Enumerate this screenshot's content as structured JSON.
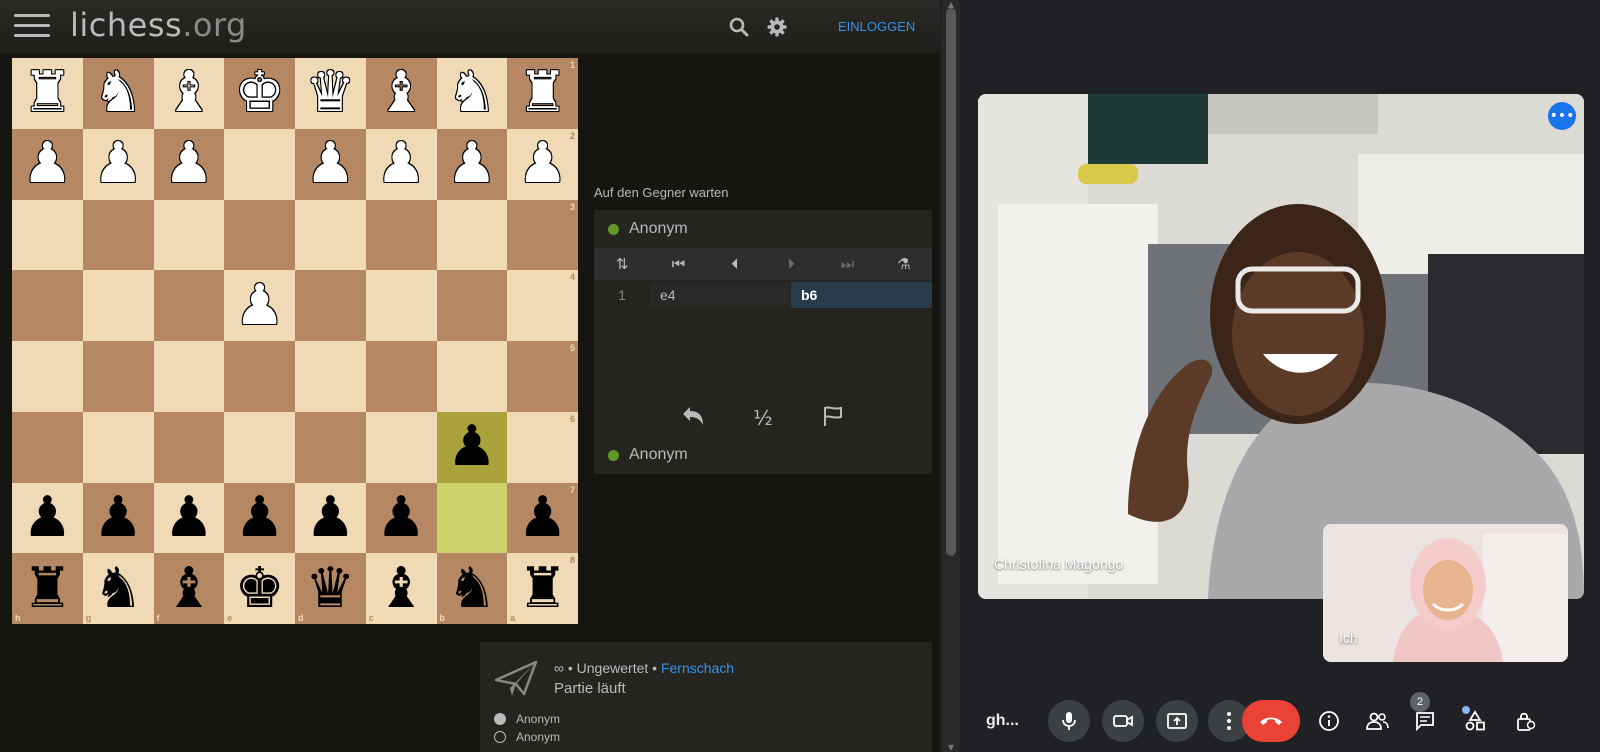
{
  "lichess": {
    "logo_main": "lichess",
    "logo_tld": ".org",
    "login_label": "EINLOGGEN",
    "waiting_text": "Auf den Gegner warten",
    "top_player": "Anonym",
    "bottom_player": "Anonym",
    "move_number": "1",
    "move_white": "e4",
    "move_black": "b6",
    "draw_label": "½",
    "game_meta_prefix": "∞ • Ungewertet • ",
    "game_meta_link": "Fernschach",
    "game_status": "Partie läuft",
    "white_player": "Anonym",
    "black_player": "Anonym",
    "board_orientation": "black",
    "highlight_squares": [
      "b7",
      "b6"
    ],
    "position": [
      [
        "R",
        "N",
        "B",
        "K",
        "Q",
        "B",
        "N",
        "R"
      ],
      [
        "P",
        "P",
        "P",
        "",
        "P",
        "P",
        "P",
        "P"
      ],
      [
        "",
        "",
        "",
        "",
        "",
        "",
        "",
        ""
      ],
      [
        "",
        "",
        "",
        "P",
        "",
        "",
        "",
        ""
      ],
      [
        "",
        "",
        "",
        "",
        "",
        "",
        "",
        ""
      ],
      [
        "",
        "",
        "",
        "",
        "",
        "",
        "p",
        ""
      ],
      [
        "p",
        "p",
        "p",
        "p",
        "p",
        "p",
        "",
        "p"
      ],
      [
        "r",
        "n",
        "b",
        "k",
        "q",
        "b",
        "n",
        "r"
      ]
    ],
    "ranks": [
      "1",
      "2",
      "3",
      "4",
      "5",
      "6",
      "7",
      "8"
    ],
    "files": [
      "h",
      "g",
      "f",
      "e",
      "d",
      "c",
      "b",
      "a"
    ]
  },
  "meet": {
    "main_participant": "Christofina Magongo",
    "self_label": "Ich",
    "meeting_code": "gh...",
    "participants_count": "2"
  }
}
